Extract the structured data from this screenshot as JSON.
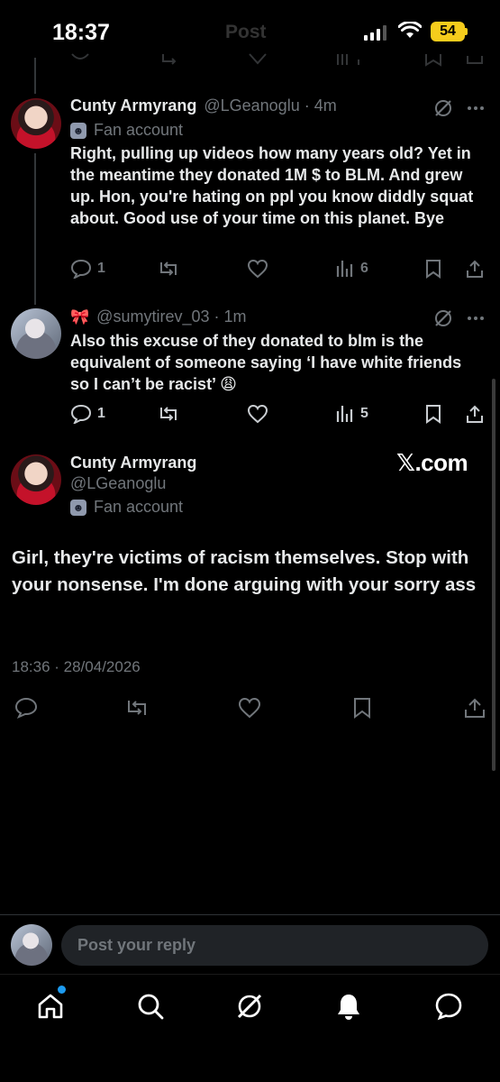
{
  "status_bar": {
    "time": "18:37",
    "screen_title": "Post",
    "battery": "54"
  },
  "reply_1": {
    "name": "Cunty Armyrang",
    "handle_time": "@LGeanoglu · 4m",
    "account_label": "Fan account",
    "text": "Right, pulling up videos how many years old? Yet in the meantime they donated 1M $ to BLM. And grew up. Hon, you're hating on ppl you know diddly squat about. Good use of your time on this planet. Bye",
    "replies": "1",
    "views": "6"
  },
  "reply_2": {
    "handle_time": "@sumytirev_03 · 1m",
    "text": "Also this excuse of they donated to blm is the equivalent of someone saying ‘I have white friends so I can’t be racist’ 😩",
    "replies": "1",
    "views": "5"
  },
  "main_post": {
    "name": "Cunty Armyrang",
    "handle": "@LGeanoglu",
    "account_label": "Fan account",
    "text": "Girl, they're victims of racism themselves. Stop with your nonsense. I'm done arguing with your sorry ass",
    "timestamp": "18:36 · 28/04/2026",
    "watermark": "𝕏.com"
  },
  "reply_composer": {
    "placeholder": "Post your reply"
  },
  "icons": {
    "reply": "speech-bubble-icon",
    "repost": "repost-arrows-icon",
    "like": "heart-icon",
    "views": "bar-chart-icon",
    "bookmark": "bookmark-icon",
    "share": "share-upload-icon",
    "grok": "grok-slash-icon",
    "more": "more-dots-icon",
    "nav": [
      "home-icon",
      "search-icon",
      "grok-icon",
      "notifications-bell-icon",
      "messages-icon"
    ]
  },
  "colors": {
    "accent": "#1d9bf0",
    "background": "#000000",
    "muted": "#71767b",
    "battery": "#f5cc1c"
  }
}
